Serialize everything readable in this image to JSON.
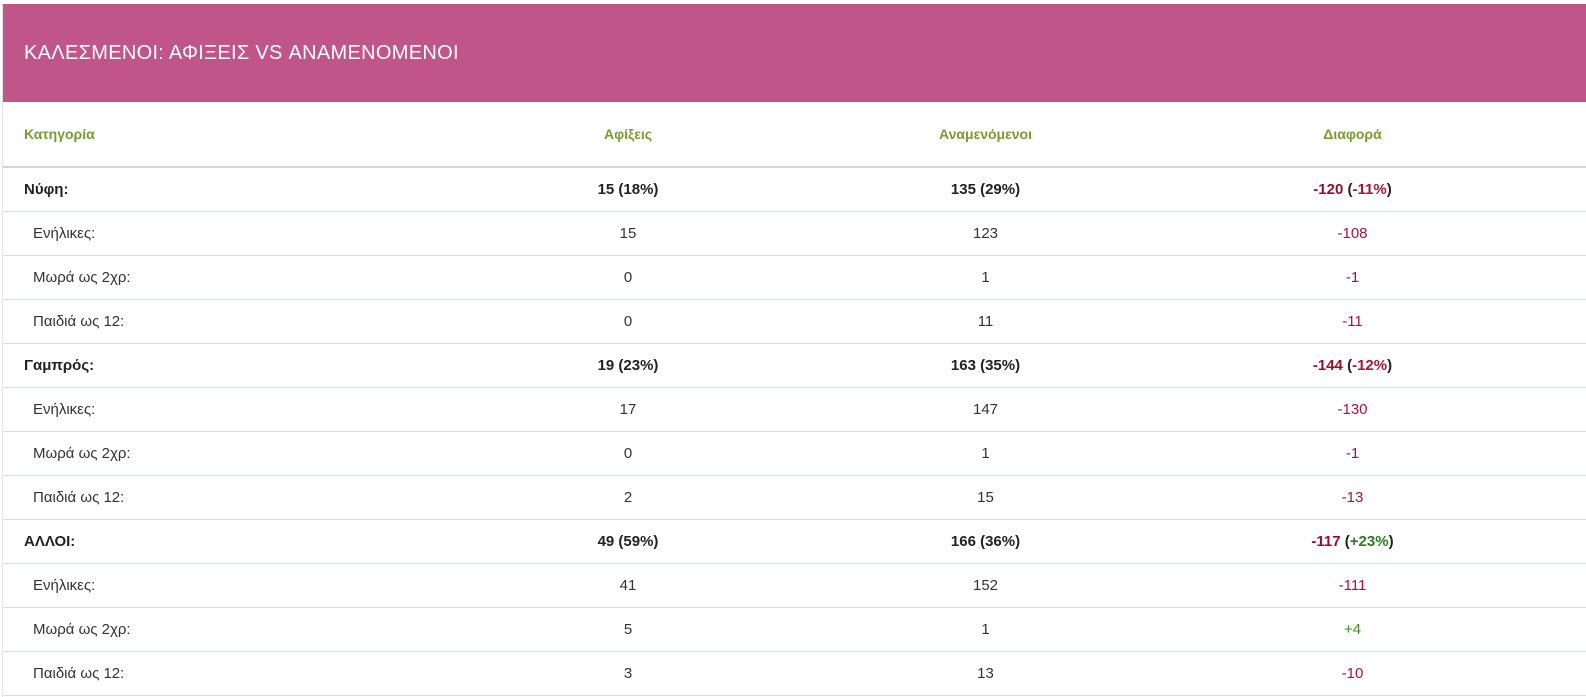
{
  "title": "ΚΑΛΕΣΜΕΝΟΙ: ΑΦΙΞΕΙΣ VS ΑΝΑΜΕΝΟΜΕΝΟΙ",
  "columns": [
    "Κατηγορία",
    "Αφίξεις",
    "Αναμενόμενοι",
    "Διαφορά"
  ],
  "rows": [
    {
      "label": "Νύφη:",
      "arrivals": "15 (18%)",
      "expected": "135 (29%)",
      "diff": "-120",
      "diff_pct": "-11%",
      "diff_sign": "neg",
      "pct_sign": "neg",
      "kind": "group"
    },
    {
      "label": "Ενήλικες:",
      "arrivals": "15",
      "expected": "123",
      "diff": "-108",
      "diff_sign": "neg",
      "kind": "sub"
    },
    {
      "label": "Μωρά ως 2χρ:",
      "arrivals": "0",
      "expected": "1",
      "diff": "-1",
      "diff_sign": "neg",
      "kind": "sub"
    },
    {
      "label": "Παιδιά ως 12:",
      "arrivals": "0",
      "expected": "11",
      "diff": "-11",
      "diff_sign": "neg",
      "kind": "sub"
    },
    {
      "label": "Γαμπρός:",
      "arrivals": "19 (23%)",
      "expected": "163 (35%)",
      "diff": "-144",
      "diff_pct": "-12%",
      "diff_sign": "neg",
      "pct_sign": "neg",
      "kind": "group"
    },
    {
      "label": "Ενήλικες:",
      "arrivals": "17",
      "expected": "147",
      "diff": "-130",
      "diff_sign": "neg",
      "kind": "sub"
    },
    {
      "label": "Μωρά ως 2χρ:",
      "arrivals": "0",
      "expected": "1",
      "diff": "-1",
      "diff_sign": "neg",
      "kind": "sub"
    },
    {
      "label": "Παιδιά ως 12:",
      "arrivals": "2",
      "expected": "15",
      "diff": "-13",
      "diff_sign": "neg",
      "kind": "sub"
    },
    {
      "label": "ΑΛΛΟΙ:",
      "arrivals": "49 (59%)",
      "expected": "166 (36%)",
      "diff": "-117",
      "diff_pct": "+23%",
      "diff_sign": "neg",
      "pct_sign": "pos",
      "kind": "group"
    },
    {
      "label": "Ενήλικες:",
      "arrivals": "41",
      "expected": "152",
      "diff": "-111",
      "diff_sign": "neg",
      "kind": "sub"
    },
    {
      "label": "Μωρά ως 2χρ:",
      "arrivals": "5",
      "expected": "1",
      "diff": "+4",
      "diff_sign": "pos",
      "kind": "sub"
    },
    {
      "label": "Παιδιά ως 12:",
      "arrivals": "3",
      "expected": "13",
      "diff": "-10",
      "diff_sign": "neg",
      "kind": "sub"
    }
  ],
  "colors": {
    "banner": "#bf5589",
    "header_text": "#7a9a32",
    "negative": "#a3163a",
    "positive": "#3e8e2f"
  }
}
